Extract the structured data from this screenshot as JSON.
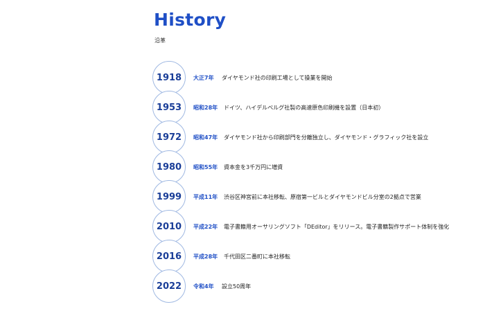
{
  "heading": {
    "title": "History",
    "subtitle": "沿革"
  },
  "history": [
    {
      "year": "1918",
      "era": "大正7年",
      "text": "ダイヤモンド社の印刷工場として操業を開始"
    },
    {
      "year": "1953",
      "era": "昭和28年",
      "text": "ドイツ、ハイデルベルグ社製の高速原色印刷機を設置（日本初）"
    },
    {
      "year": "1972",
      "era": "昭和47年",
      "text": "ダイヤモンド社から印刷部門を分離独立し、ダイヤモンド・グラフィック社を設立"
    },
    {
      "year": "1980",
      "era": "昭和55年",
      "text": "資本金を3千万円に増資"
    },
    {
      "year": "1999",
      "era": "平成11年",
      "text": "渋谷区神宮前に本社移転、原宿第一ビルとダイヤモンドビル分室の2拠点で営業"
    },
    {
      "year": "2010",
      "era": "平成22年",
      "text": "電子書籍用オーサリングソフト「DEditor」をリリース。電子書籍製作サポート体制を強化"
    },
    {
      "year": "2016",
      "era": "平成28年",
      "text": "千代田区二番町に本社移転"
    },
    {
      "year": "2022",
      "era": "令和4年",
      "text": "設立50周年"
    }
  ]
}
